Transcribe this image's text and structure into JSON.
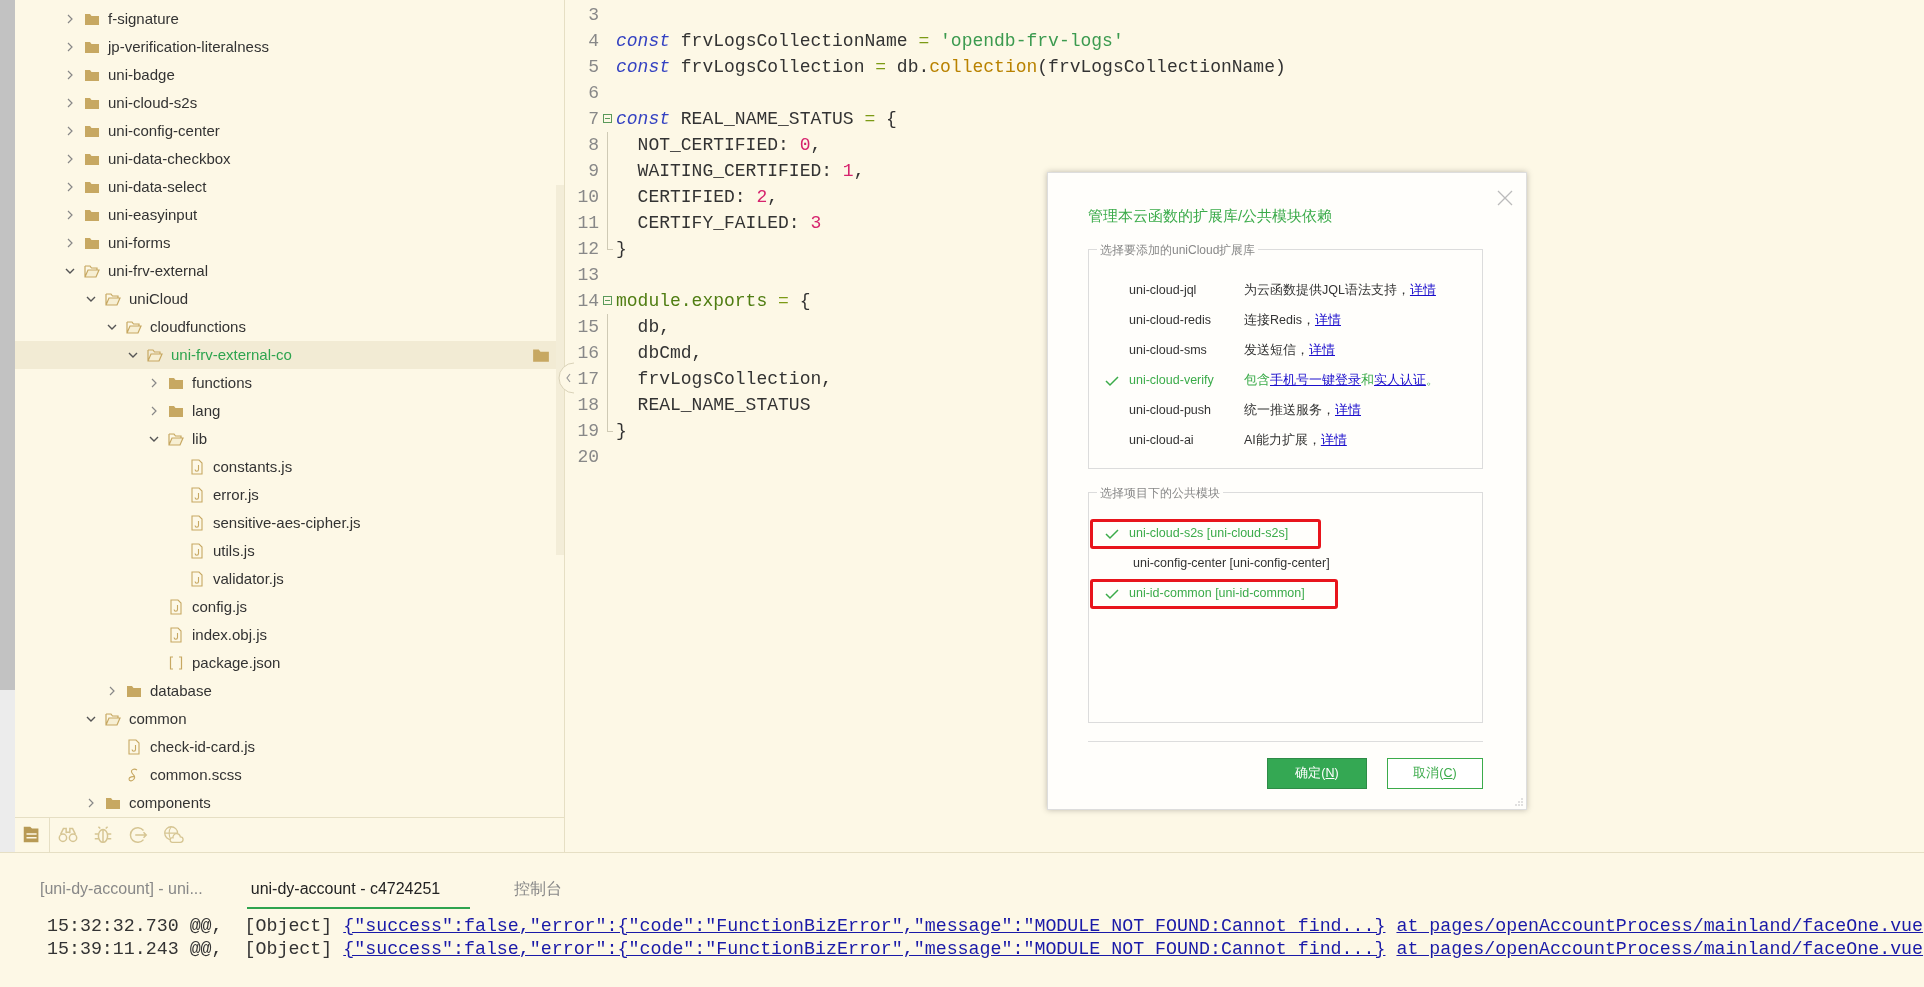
{
  "explorer": {
    "tree": [
      {
        "name": "f-signature",
        "kind": "folder",
        "expanded": false,
        "selected": false
      },
      {
        "name": "jp-verification-literalness",
        "kind": "folder",
        "expanded": false,
        "selected": false
      },
      {
        "name": "uni-badge",
        "kind": "folder",
        "expanded": false,
        "selected": false
      },
      {
        "name": "uni-cloud-s2s",
        "kind": "folder",
        "expanded": false,
        "selected": false
      },
      {
        "name": "uni-config-center",
        "kind": "folder",
        "expanded": false,
        "selected": false
      },
      {
        "name": "uni-data-checkbox",
        "kind": "folder",
        "expanded": false,
        "selected": false
      },
      {
        "name": "uni-data-select",
        "kind": "folder",
        "expanded": false,
        "selected": false
      },
      {
        "name": "uni-easyinput",
        "kind": "folder",
        "expanded": false,
        "selected": false
      },
      {
        "name": "uni-forms",
        "kind": "folder",
        "expanded": false,
        "selected": false
      },
      {
        "name": "uni-frv-external",
        "kind": "folder",
        "expanded": true,
        "selected": false,
        "children": [
          {
            "name": "uniCloud",
            "kind": "folder",
            "expanded": true,
            "selected": false,
            "children": [
              {
                "name": "cloudfunctions",
                "kind": "folder",
                "expanded": true,
                "selected": false,
                "children": [
                  {
                    "name": "uni-frv-external-co",
                    "kind": "folder",
                    "expanded": true,
                    "selected": true,
                    "children": [
                      {
                        "name": "functions",
                        "kind": "folder",
                        "expanded": false,
                        "selected": false
                      },
                      {
                        "name": "lang",
                        "kind": "folder",
                        "expanded": false,
                        "selected": false
                      },
                      {
                        "name": "lib",
                        "kind": "folder",
                        "expanded": true,
                        "selected": false,
                        "children": [
                          {
                            "name": "constants.js",
                            "kind": "js",
                            "selected": false
                          },
                          {
                            "name": "error.js",
                            "kind": "js",
                            "selected": false
                          },
                          {
                            "name": "sensitive-aes-cipher.js",
                            "kind": "js",
                            "selected": false
                          },
                          {
                            "name": "utils.js",
                            "kind": "js",
                            "selected": false
                          },
                          {
                            "name": "validator.js",
                            "kind": "js",
                            "selected": false
                          }
                        ]
                      },
                      {
                        "name": "config.js",
                        "kind": "js",
                        "selected": false
                      },
                      {
                        "name": "index.obj.js",
                        "kind": "js",
                        "selected": false
                      },
                      {
                        "name": "package.json",
                        "kind": "json",
                        "selected": false
                      }
                    ]
                  }
                ]
              },
              {
                "name": "database",
                "kind": "folder",
                "expanded": false,
                "selected": false
              }
            ]
          },
          {
            "name": "common",
            "kind": "folder",
            "expanded": true,
            "selected": false,
            "children": [
              {
                "name": "check-id-card.js",
                "kind": "js",
                "selected": false
              },
              {
                "name": "common.scss",
                "kind": "scss",
                "selected": false
              }
            ]
          },
          {
            "name": "components",
            "kind": "folder",
            "expanded": false,
            "selected": false
          }
        ]
      }
    ],
    "toolbar": [
      {
        "kind": "files",
        "selected": true
      },
      {
        "kind": "search",
        "selected": false
      },
      {
        "kind": "debug",
        "selected": false
      },
      {
        "kind": "export",
        "selected": false
      },
      {
        "kind": "cloud",
        "selected": false
      }
    ]
  },
  "editor": {
    "lines": [
      {
        "number": "3",
        "kind": "plain"
      },
      {
        "number": "4",
        "kind": "plain",
        "tokens": [
          {
            "keyword": "const"
          },
          {
            "plain": " frvLogsCollectionName"
          },
          {
            "op": " = "
          },
          {
            "string": "'opendb-frv-logs'"
          }
        ]
      },
      {
        "number": "5",
        "kind": "plain",
        "tokens": [
          {
            "keyword": "const"
          },
          {
            "plain": " frvLogsCollection"
          },
          {
            "op": " = "
          },
          {
            "plain": "db."
          },
          {
            "method": "collection"
          },
          {
            "plain": "(frvLogsCollectionName)"
          }
        ]
      },
      {
        "number": "6",
        "kind": "plain"
      },
      {
        "number": "7",
        "kind": "foldable",
        "tokens": [
          {
            "keyword": "const"
          },
          {
            "plain": " REAL_NAME_STATUS"
          },
          {
            "op": " = "
          },
          {
            "plain": "{"
          }
        ]
      },
      {
        "number": "8",
        "kind": "inside",
        "tokens": [
          {
            "plain": "  NOT_CERTIFIED: "
          },
          {
            "number": "0"
          },
          {
            "plain": ","
          }
        ]
      },
      {
        "number": "9",
        "kind": "inside",
        "tokens": [
          {
            "plain": "  WAITING_CERTIFIED: "
          },
          {
            "number": "1"
          },
          {
            "plain": ","
          }
        ]
      },
      {
        "number": "10",
        "kind": "inside",
        "tokens": [
          {
            "plain": "  CERTIFIED: "
          },
          {
            "number": "2"
          },
          {
            "plain": ","
          }
        ]
      },
      {
        "number": "11",
        "kind": "inside",
        "tokens": [
          {
            "plain": "  CERTIFY_FAILED: "
          },
          {
            "number": "3"
          }
        ]
      },
      {
        "number": "12",
        "kind": "closing",
        "tokens": [
          {
            "plain": "}"
          }
        ]
      },
      {
        "number": "13",
        "kind": "plain"
      },
      {
        "number": "14",
        "kind": "foldable",
        "tokens": [
          {
            "module": "module.exports"
          },
          {
            "op": " = "
          },
          {
            "plain": "{"
          }
        ]
      },
      {
        "number": "15",
        "kind": "inside",
        "tokens": [
          {
            "plain": "  db,"
          }
        ]
      },
      {
        "number": "16",
        "kind": "inside",
        "tokens": [
          {
            "plain": "  dbCmd,"
          }
        ]
      },
      {
        "number": "17",
        "kind": "inside",
        "tokens": [
          {
            "plain": "  frvLogsCollection,"
          }
        ]
      },
      {
        "number": "18",
        "kind": "inside",
        "tokens": [
          {
            "plain": "  REAL_NAME_STATUS"
          }
        ]
      },
      {
        "number": "19",
        "kind": "closing",
        "tokens": [
          {
            "plain": "}"
          }
        ]
      },
      {
        "number": "20",
        "kind": "plain"
      }
    ]
  },
  "dialog": {
    "title": "管理本云函数的扩展库/公共模块依赖",
    "extensions": {
      "legend": "选择要添加的uniCloud扩展库",
      "items": [
        {
          "name": "uni-cloud-jql",
          "checked": false,
          "description": [
            {
              "text": "为云函数提供JQL语法支持，"
            },
            {
              "link": "详情"
            }
          ]
        },
        {
          "name": "uni-cloud-redis",
          "checked": false,
          "description": [
            {
              "text": "连接Redis，"
            },
            {
              "link": "详情"
            }
          ]
        },
        {
          "name": "uni-cloud-sms",
          "checked": false,
          "description": [
            {
              "text": "发送短信，"
            },
            {
              "link": "详情"
            }
          ]
        },
        {
          "name": "uni-cloud-verify",
          "checked": true,
          "description": [
            {
              "text": "包含"
            },
            {
              "link": "手机号一键登录"
            },
            {
              "text": "和"
            },
            {
              "link": "实人认证"
            },
            {
              "text": "。"
            }
          ]
        },
        {
          "name": "uni-cloud-push",
          "checked": false,
          "description": [
            {
              "text": "统一推送服务，"
            },
            {
              "link": "详情"
            }
          ]
        },
        {
          "name": "uni-cloud-ai",
          "checked": false,
          "description": [
            {
              "text": "AI能力扩展，"
            },
            {
              "link": "详情"
            }
          ]
        }
      ]
    },
    "modules": {
      "legend": "选择项目下的公共模块",
      "items": [
        {
          "name": "uni-cloud-s2s [uni-cloud-s2s]",
          "checked": true,
          "highlighted": true
        },
        {
          "name": "uni-config-center [uni-config-center]",
          "checked": false,
          "highlighted": false
        },
        {
          "name": "uni-id-common [uni-id-common]",
          "checked": true,
          "highlighted": true
        }
      ]
    },
    "buttons": [
      {
        "kind": "primary",
        "before": "确定(",
        "key": "N",
        "after": ")"
      },
      {
        "kind": "secondary",
        "before": "取消(",
        "key": "C",
        "after": ")"
      }
    ]
  },
  "console": {
    "tabs": [
      {
        "label": "[uni-dy-account] - uni...",
        "selected": false
      },
      {
        "label": "uni-dy-account - c4724251",
        "selected": true
      },
      {
        "label": "控制台",
        "selected": false
      }
    ],
    "logs": [
      {
        "time": "15:32:32.730",
        "marker": "@@,",
        "type": "[Object]",
        "message": "{\"success\":false,\"error\":{\"code\":\"FunctionBizError\",\"message\":\"MODULE_NOT_FOUND:Cannot find...}",
        "source": "at pages/openAccountProcess/mainland/faceOne.vue"
      },
      {
        "time": "15:39:11.243",
        "marker": "@@,",
        "type": "[Object]",
        "message": "{\"success\":false,\"error\":{\"code\":\"FunctionBizError\",\"message\":\"MODULE_NOT_FOUND:Cannot find...}",
        "source": "at pages/openAccountProcess/mainland/faceOne.vue"
      }
    ]
  }
}
